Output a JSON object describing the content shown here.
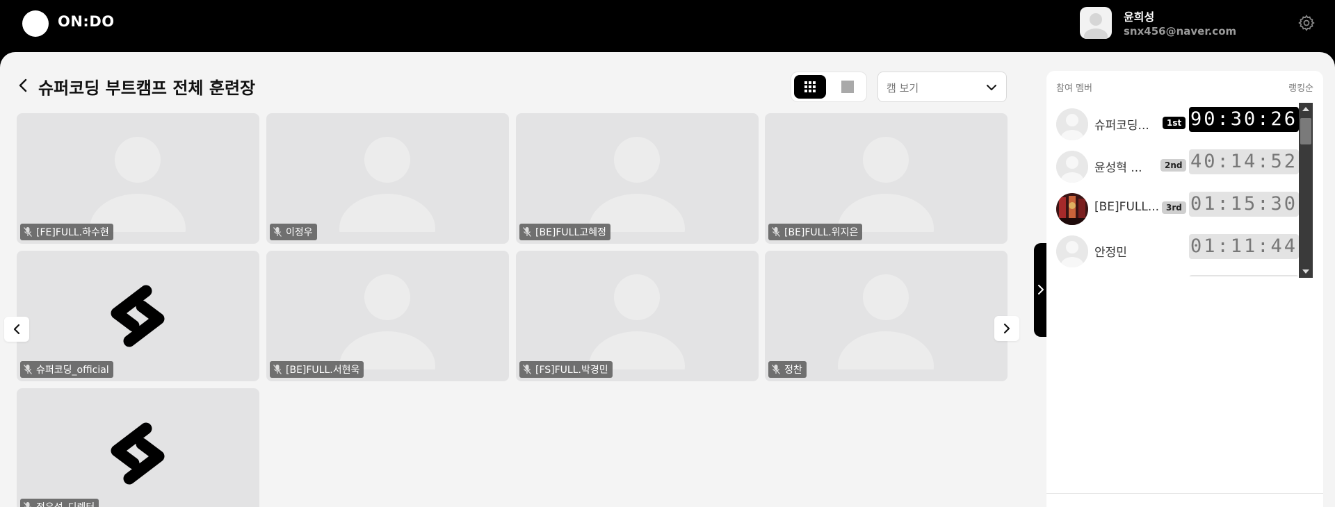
{
  "app": {
    "logo_text": "ON:DO"
  },
  "user": {
    "name": "윤희성",
    "email": "snx456@naver.com"
  },
  "room": {
    "title": "슈퍼코딩 부트캠프 전체 훈련장"
  },
  "view": {
    "mode": "grid",
    "dropdown_selected": "캠 보기"
  },
  "participants": [
    {
      "name": "[FE]FULL.하수현",
      "avatar": "default",
      "muted": true
    },
    {
      "name": "이정우",
      "avatar": "default",
      "muted": true
    },
    {
      "name": "[BE]FULL고혜정",
      "avatar": "default",
      "muted": true
    },
    {
      "name": "[BE]FULL.위지은",
      "avatar": "default",
      "muted": true
    },
    {
      "name": "슈퍼코딩_official",
      "avatar": "brand-logo",
      "muted": true
    },
    {
      "name": "[BE]FULL.서현욱",
      "avatar": "default",
      "muted": true
    },
    {
      "name": "[FS]FULL.박경민",
      "avatar": "default",
      "muted": true
    },
    {
      "name": "정찬",
      "avatar": "default",
      "muted": true
    },
    {
      "name": "정우성_디렉터",
      "avatar": "brand-logo",
      "muted": true
    }
  ],
  "ranking": {
    "header_left": "참여 멤버",
    "header_right": "랭킹순",
    "members": [
      {
        "name": "슈퍼코딩...",
        "badge": "1st",
        "time": "90:30:26",
        "avatar": "default"
      },
      {
        "name": "윤성혁 ...",
        "badge": "2nd",
        "time": "40:14:52",
        "avatar": "default"
      },
      {
        "name": "[BE]FULL...",
        "badge": "3rd",
        "time": "01:15:30",
        "avatar": "photo"
      },
      {
        "name": "안정민",
        "badge": "",
        "time": "01:11:44",
        "avatar": "default"
      }
    ]
  },
  "colors": {
    "header_bg": "#000000",
    "page_bg": "#f4f4f4",
    "tile_bg": "#e3e3e4",
    "accent": "#000000"
  }
}
